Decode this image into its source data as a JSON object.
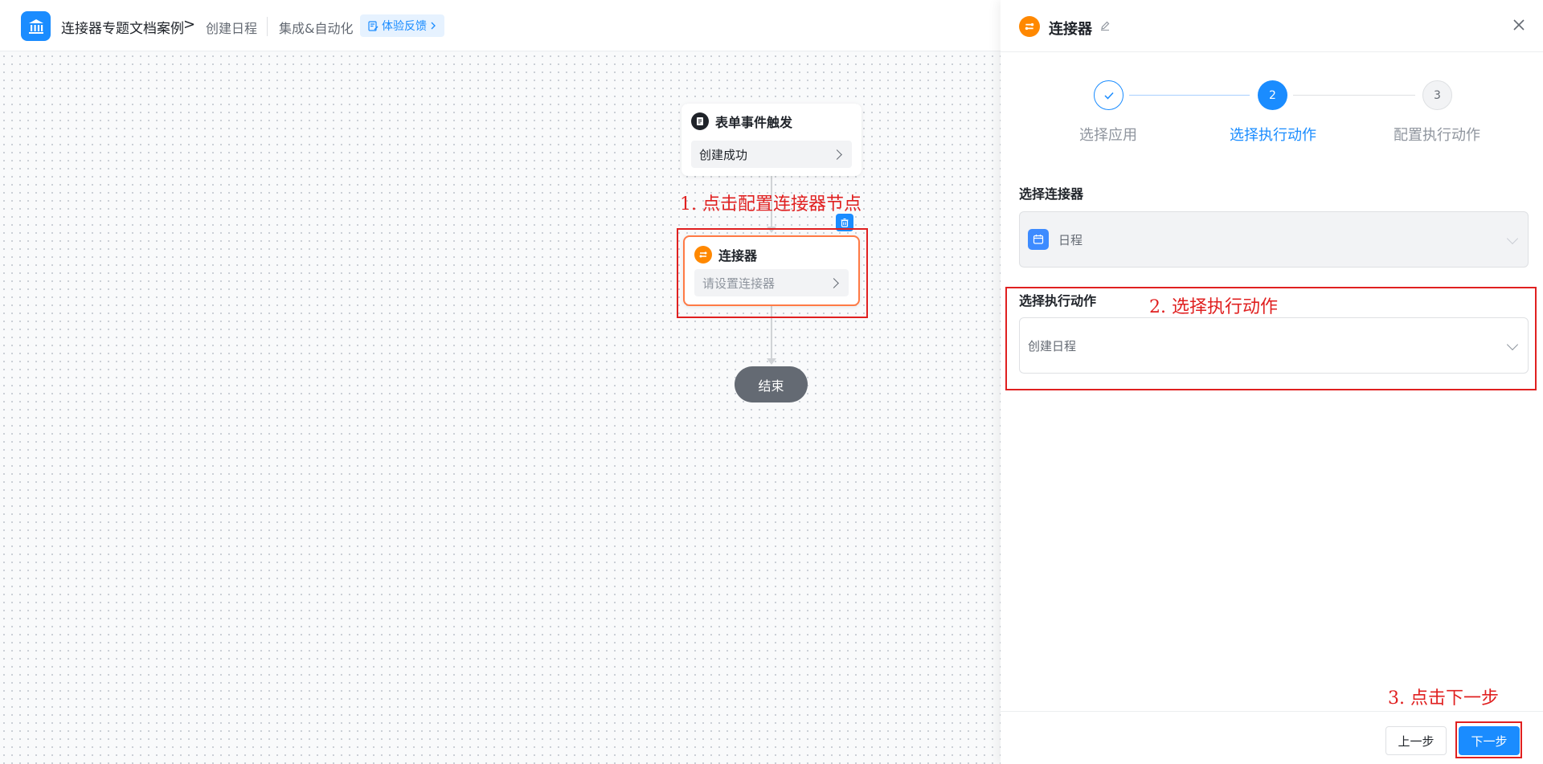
{
  "header": {
    "app_title": "连接器专题文档案例",
    "breadcrumb_separator": ">",
    "page_name": "创建日程",
    "module_name": "集成&自动化",
    "feedback_label": "体验反馈"
  },
  "flow": {
    "trigger_node": {
      "title": "表单事件触发",
      "value": "创建成功"
    },
    "connector_node": {
      "title": "连接器",
      "placeholder": "请设置连接器"
    },
    "end_node": {
      "label": "结束"
    }
  },
  "panel": {
    "title": "连接器",
    "steps": [
      {
        "label": "选择应用",
        "state": "done"
      },
      {
        "number": "2",
        "label": "选择执行动作",
        "state": "active"
      },
      {
        "number": "3",
        "label": "配置执行动作",
        "state": "todo"
      }
    ],
    "connector_field": {
      "label": "选择连接器",
      "value": "日程"
    },
    "action_field": {
      "label": "选择执行动作",
      "value": "创建日程"
    },
    "prev_label": "上一步",
    "next_label": "下一步"
  },
  "annotations": {
    "step1": "1. 点击配置连接器节点",
    "step2": "2. 选择执行动作",
    "step3": "3. 点击下一步"
  },
  "colors": {
    "primary": "#1a8cff",
    "connector_orange": "#ff8800",
    "annotation_red": "#e02020"
  }
}
